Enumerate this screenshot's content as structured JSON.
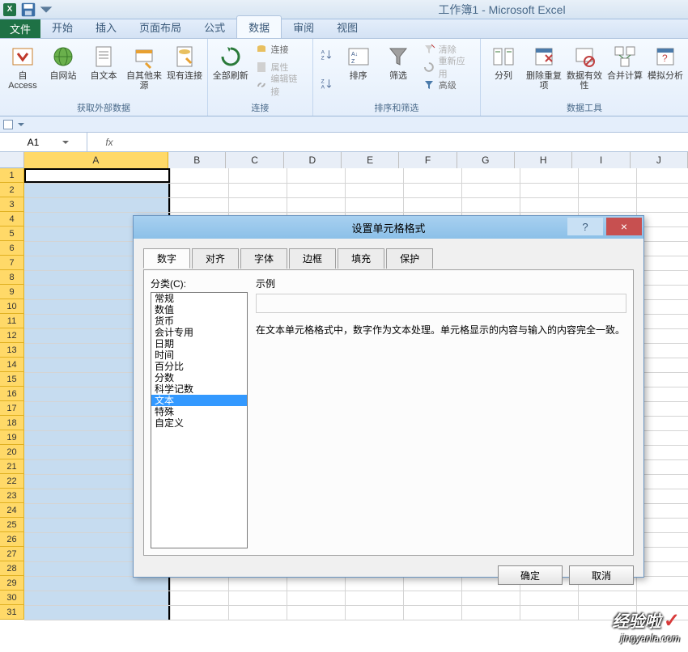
{
  "app": {
    "title": "工作簿1 - Microsoft Excel",
    "excel_glyph": "X"
  },
  "ribbon": {
    "tabs": {
      "file": "文件",
      "home": "开始",
      "insert": "插入",
      "layout": "页面布局",
      "formulas": "公式",
      "data": "数据",
      "review": "审阅",
      "view": "视图"
    },
    "groups": {
      "external": {
        "label": "获取外部数据",
        "access": "自 Access",
        "web": "自网站",
        "text": "自文本",
        "other": "自其他来源",
        "existing": "现有连接"
      },
      "connections": {
        "label": "连接",
        "refresh": "全部刷新",
        "conn": "连接",
        "prop": "属性",
        "editlink": "编辑链接"
      },
      "sort": {
        "label": "排序和筛选",
        "sort": "排序",
        "filter": "筛选",
        "clear": "清除",
        "reapply": "重新应用",
        "advanced": "高级"
      },
      "tools": {
        "label": "数据工具",
        "texttocol": "分列",
        "remove": "删除重复项",
        "validation": "数据有效性",
        "consolidate": "合并计算",
        "whatif": "模拟分析"
      }
    }
  },
  "namebox": {
    "cell": "A1",
    "fx": "fx"
  },
  "columns": [
    "A",
    "B",
    "C",
    "D",
    "E",
    "F",
    "G",
    "H",
    "I",
    "J"
  ],
  "dialog": {
    "title": "设置单元格格式",
    "help": "?",
    "close": "×",
    "tabs": {
      "number": "数字",
      "align": "对齐",
      "font": "字体",
      "border": "边框",
      "fill": "填充",
      "protect": "保护"
    },
    "category_label": "分类(C):",
    "categories": [
      "常规",
      "数值",
      "货币",
      "会计专用",
      "日期",
      "时间",
      "百分比",
      "分数",
      "科学记数",
      "文本",
      "特殊",
      "自定义"
    ],
    "selected_index": 9,
    "sample_label": "示例",
    "description": "在文本单元格格式中，数字作为文本处理。单元格显示的内容与输入的内容完全一致。",
    "ok": "确定",
    "cancel": "取消"
  },
  "watermark": {
    "text": "经验啦",
    "check": "✓",
    "url": "jingyanla.com"
  }
}
